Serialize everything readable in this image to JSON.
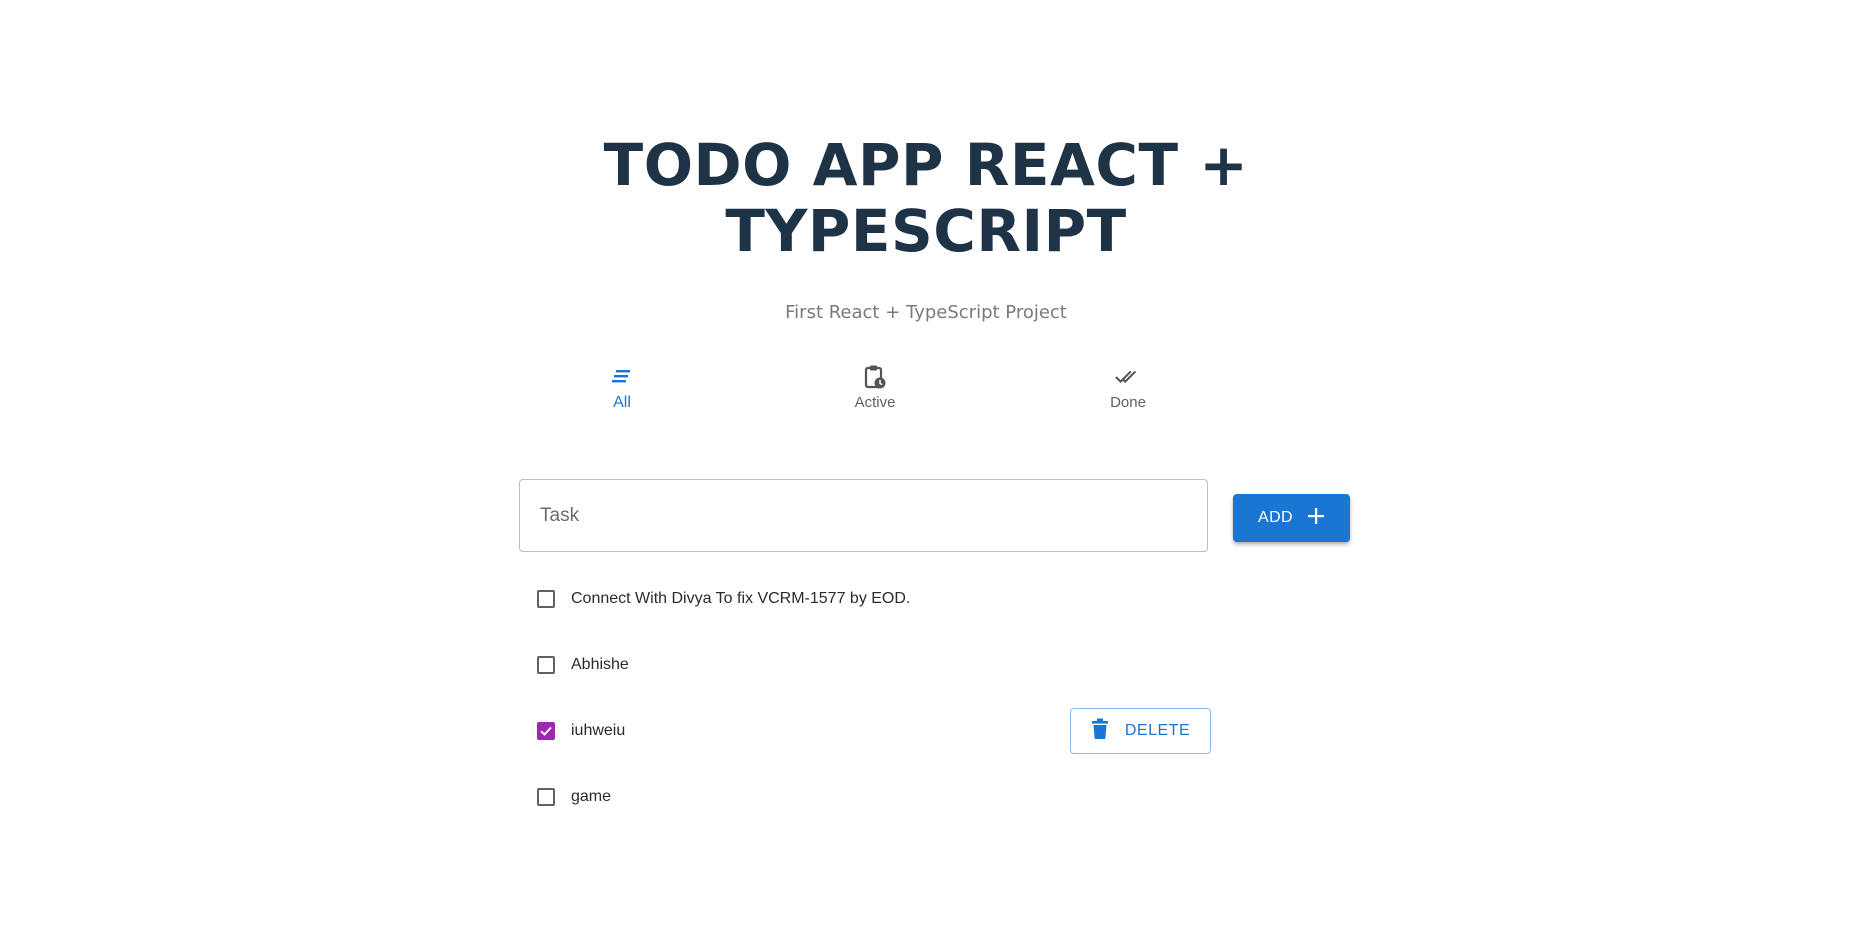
{
  "header": {
    "title_line1": "TODO APP REACT +",
    "title_line2": "TYPESCRIPT",
    "subtitle": "First React + TypeScript Project"
  },
  "tabs": [
    {
      "label": "All",
      "icon": "list-icon",
      "active": true
    },
    {
      "label": "Active",
      "icon": "clipboard-clock-icon",
      "active": false
    },
    {
      "label": "Done",
      "icon": "double-check-icon",
      "active": false
    }
  ],
  "task_input": {
    "placeholder": "Task",
    "value": ""
  },
  "add_button": {
    "label": "ADD",
    "icon": "plus-icon"
  },
  "todos": [
    {
      "text": "Connect With Divya To fix VCRM-1577 by EOD.",
      "checked": false
    },
    {
      "text": "Abhishe",
      "checked": false
    },
    {
      "text": "iuhweiu",
      "checked": true,
      "delete_label": "DELETE"
    },
    {
      "text": "game",
      "checked": false
    }
  ],
  "colors": {
    "primary": "#1976d2",
    "checked": "#9c27b0",
    "title": "#1f3347",
    "subtitle": "#7a7a7a"
  }
}
